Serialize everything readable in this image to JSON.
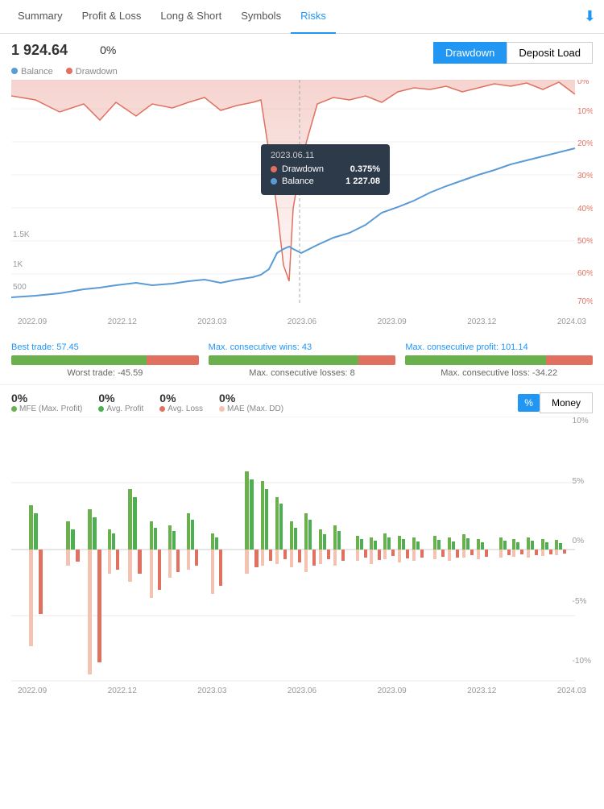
{
  "nav": {
    "items": [
      {
        "label": "Summary",
        "active": false
      },
      {
        "label": "Profit & Loss",
        "active": false
      },
      {
        "label": "Long & Short",
        "active": false
      },
      {
        "label": "Symbols",
        "active": false
      },
      {
        "label": "Risks",
        "active": true
      }
    ],
    "download_icon": "⬇"
  },
  "chart1": {
    "value": "1 924.64",
    "pct": "0%",
    "btn_drawdown": "Drawdown",
    "btn_deposit": "Deposit Load",
    "legend_balance": "Balance",
    "legend_drawdown": "Drawdown",
    "tooltip": {
      "date": "2023.06.11",
      "drawdown_label": "Drawdown",
      "drawdown_val": "0.375%",
      "balance_label": "Balance",
      "balance_val": "1 227.08"
    },
    "y_left": [
      "1.5K",
      "1K",
      "500"
    ],
    "y_right": [
      "0%",
      "10%",
      "20%",
      "30%",
      "40%",
      "50%",
      "60%",
      "70%"
    ],
    "x_axis": [
      "2022.09",
      "2022.12",
      "2023.03",
      "2023.06",
      "2023.09",
      "2023.12",
      "2024.03"
    ]
  },
  "stats": {
    "best_trade_label": "Best trade: 57.45",
    "worst_trade_label": "Worst trade: -45.59",
    "max_wins_label": "Max. consecutive wins: 43",
    "max_losses_label": "Max. consecutive losses: 8",
    "max_profit_label": "Max. consecutive profit: 101.14",
    "max_loss_label": "Max. consecutive loss: -34.22",
    "bar1_green": 72,
    "bar1_red": 28,
    "bar2_green": 80,
    "bar2_red": 20,
    "bar3_green": 75,
    "bar3_red": 25
  },
  "chart2": {
    "pct1": "0%",
    "pct1_label": "MFE (Max. Profit)",
    "pct2": "0%",
    "pct2_label": "Avg. Profit",
    "pct3": "0%",
    "pct3_label": "Avg. Loss",
    "pct4": "0%",
    "pct4_label": "MAE (Max. DD)",
    "btn_pct": "%",
    "btn_money": "Money",
    "y_right": [
      "10%",
      "5%",
      "0%",
      "-5%",
      "-10%"
    ],
    "x_axis": [
      "2022.09",
      "2022.12",
      "2023.03",
      "2023.06",
      "2023.09",
      "2023.12",
      "2024.03"
    ]
  }
}
